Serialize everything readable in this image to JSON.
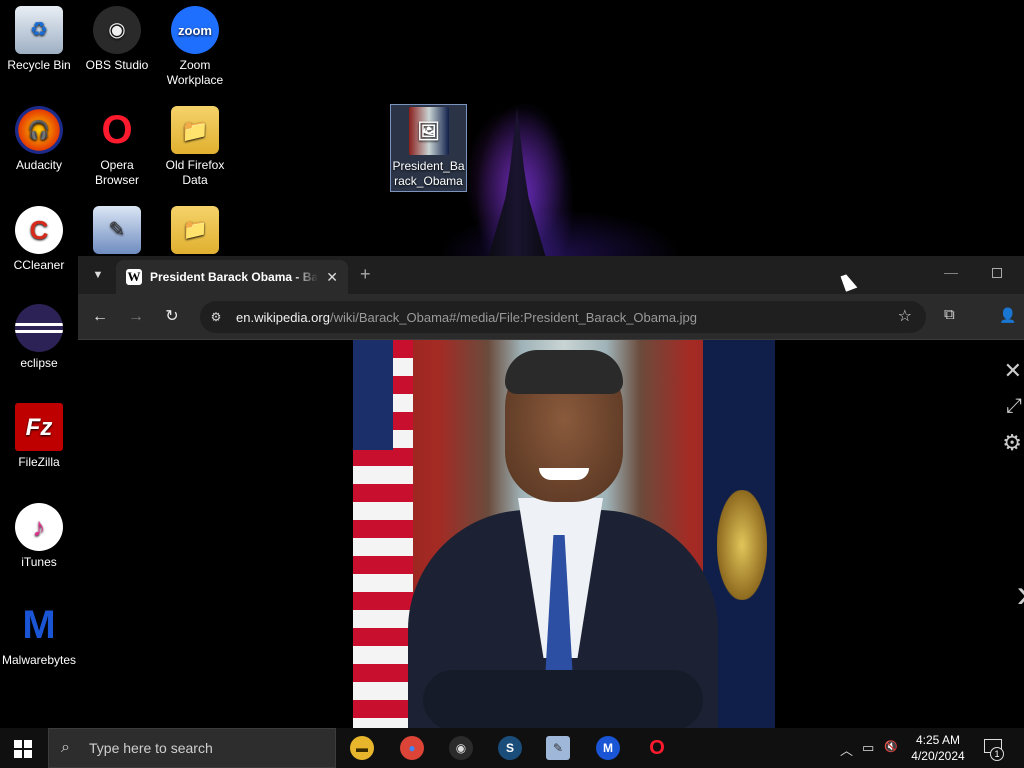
{
  "desktop": {
    "icons": [
      {
        "label": "Recycle Bin",
        "glyph": "♻"
      },
      {
        "label": "OBS Studio",
        "glyph": "◉"
      },
      {
        "label": "Zoom Workplace",
        "glyph": "zoom"
      },
      {
        "label": "Audacity",
        "glyph": "🎧"
      },
      {
        "label": "Opera Browser",
        "glyph": "O"
      },
      {
        "label": "Old Firefox Data",
        "glyph": "📁"
      },
      {
        "label": "President_Barack_Obama",
        "glyph": "🖼"
      },
      {
        "label": "CCleaner",
        "glyph": "C"
      },
      {
        "label": "eclipse",
        "glyph": "◐"
      },
      {
        "label": "FileZilla",
        "glyph": "Fz"
      },
      {
        "label": "iTunes",
        "glyph": "♪"
      },
      {
        "label": "Malwarebytes",
        "glyph": "M"
      }
    ]
  },
  "browser": {
    "tab": {
      "favicon": "W",
      "title": "President Barack Obama - Barack Obama - Wikipedia",
      "close": "✕"
    },
    "new_tab": "+",
    "window": {
      "minimize": "—",
      "maximize": ""
    },
    "nav": {
      "back": "←",
      "forward": "→",
      "reload": "↻"
    },
    "address": {
      "site_info_icon": "⚙",
      "host": "en.wikipedia.org",
      "path": "/wiki/Barack_Obama#/media/File:President_Barack_Obama.jpg"
    },
    "bookmark_star": "☆",
    "extensions": "⧉",
    "profile": "👤",
    "viewer": {
      "close": "✕",
      "expand": "⤢",
      "settings": "⚙",
      "next": "›"
    }
  },
  "taskbar": {
    "search_placeholder": "Type here to search",
    "apps": [
      {
        "name": "File Explorer",
        "glyph": "▬",
        "bg": "#e8b62c",
        "fg": "#3a2a00"
      },
      {
        "name": "Google Chrome",
        "glyph": "●",
        "bg": "#db4437",
        "fg": "#4285f4"
      },
      {
        "name": "OBS Studio",
        "glyph": "◉",
        "bg": "#2b2b2b",
        "fg": "#ddd"
      },
      {
        "name": "Steam",
        "glyph": "S",
        "bg": "#1b4d7a",
        "fg": "#fff"
      },
      {
        "name": "Paint",
        "glyph": "✎",
        "bg": "#9fb7d9",
        "fg": "#333"
      },
      {
        "name": "Malwarebytes",
        "glyph": "M",
        "bg": "#1a55d6",
        "fg": "#fff"
      },
      {
        "name": "Opera",
        "glyph": "O",
        "bg": "#101010",
        "fg": "#ff1b2d"
      }
    ],
    "tray": {
      "chevron": "︿",
      "network": "▭",
      "volume": "🔇"
    },
    "time": "4:25 AM",
    "date": "4/20/2024",
    "notifications": "1"
  }
}
